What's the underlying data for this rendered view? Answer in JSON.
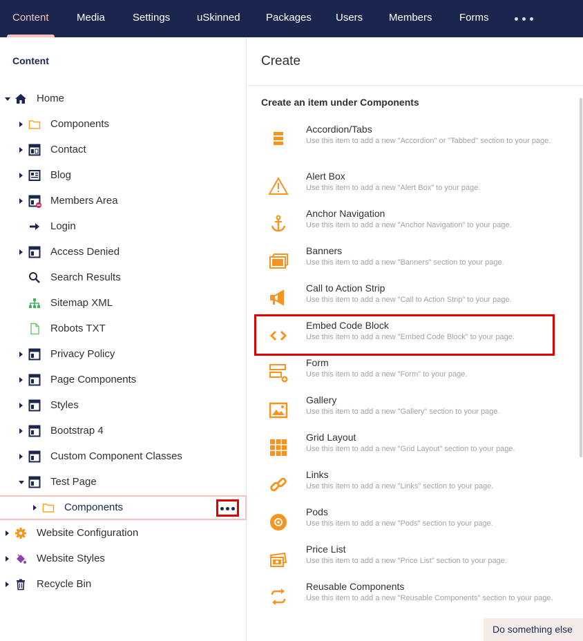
{
  "topnav": {
    "tabs": [
      {
        "label": "Content",
        "active": true
      },
      {
        "label": "Media"
      },
      {
        "label": "Settings"
      },
      {
        "label": "uSkinned"
      },
      {
        "label": "Packages"
      },
      {
        "label": "Users"
      },
      {
        "label": "Members"
      },
      {
        "label": "Forms"
      }
    ]
  },
  "tree": {
    "title": "Content",
    "nodes": [
      {
        "label": "Home",
        "icon": "home-icon"
      },
      {
        "label": "Components",
        "icon": "folder-icon"
      },
      {
        "label": "Contact",
        "icon": "page-layout-icon"
      },
      {
        "label": "Blog",
        "icon": "newspaper-icon"
      },
      {
        "label": "Members Area",
        "icon": "restricted-page-icon"
      },
      {
        "label": "Login",
        "icon": "arrow-right-icon"
      },
      {
        "label": "Access Denied",
        "icon": "page-layout-icon"
      },
      {
        "label": "Search Results",
        "icon": "search-icon"
      },
      {
        "label": "Sitemap XML",
        "icon": "sitemap-icon"
      },
      {
        "label": "Robots TXT",
        "icon": "document-icon"
      },
      {
        "label": "Privacy Policy",
        "icon": "page-layout-icon"
      },
      {
        "label": "Page Components",
        "icon": "page-layout-icon"
      },
      {
        "label": "Styles",
        "icon": "page-layout-icon"
      },
      {
        "label": "Bootstrap 4",
        "icon": "page-layout-icon"
      },
      {
        "label": "Custom Component Classes",
        "icon": "page-layout-icon"
      },
      {
        "label": "Test Page",
        "icon": "page-layout-icon"
      },
      {
        "label": "Components",
        "icon": "folder-icon"
      },
      {
        "label": "Website Configuration",
        "icon": "gear-icon"
      },
      {
        "label": "Website Styles",
        "icon": "paint-icon"
      },
      {
        "label": "Recycle Bin",
        "icon": "trash-icon"
      }
    ]
  },
  "panel": {
    "title": "Create",
    "subtitle": "Create an item under Components",
    "items": [
      {
        "name": "Accordion/Tabs",
        "desc": "Use this item to add a new \"Accordion\" or \"Tabbed\" section to your page.",
        "icon": "accordion-icon"
      },
      {
        "name": "Alert Box",
        "desc": "Use this item to add a new \"Alert Box\" to your page.",
        "icon": "alert-icon"
      },
      {
        "name": "Anchor Navigation",
        "desc": "Use this item to add a new \"Anchor Navigation\" to your page.",
        "icon": "anchor-icon"
      },
      {
        "name": "Banners",
        "desc": "Use this item to add a new \"Banners\" section to your page.",
        "icon": "banners-icon"
      },
      {
        "name": "Call to Action Strip",
        "desc": "Use this item to add a new \"Call to Action Strip\" to your page.",
        "icon": "megaphone-icon"
      },
      {
        "name": "Embed Code Block",
        "desc": "Use this item to add a new \"Embed Code Block\" to your page.",
        "icon": "code-icon"
      },
      {
        "name": "Form",
        "desc": "Use this item to add a new \"Form\" to your page.",
        "icon": "form-icon"
      },
      {
        "name": "Gallery",
        "desc": "Use this item to add a new \"Gallery\" section to your page.",
        "icon": "gallery-icon"
      },
      {
        "name": "Grid Layout",
        "desc": "Use this item to add a new \"Grid Layout\" section to your page.",
        "icon": "grid-icon"
      },
      {
        "name": "Links",
        "desc": "Use this item to add a new \"Links\" section to your page.",
        "icon": "link-icon"
      },
      {
        "name": "Pods",
        "desc": "Use this item to add a new \"Pods\" section to your page.",
        "icon": "pods-icon"
      },
      {
        "name": "Price List",
        "desc": "Use this item to add a new \"Price List\" section to your page.",
        "icon": "price-list-icon"
      },
      {
        "name": "Reusable Components",
        "desc": "Use this item to add a new \"Reusable Components\" section to your page.",
        "icon": "reusable-icon"
      }
    ]
  },
  "footer": {
    "do_something_else": "Do something else"
  },
  "colors": {
    "nav_bg": "#1b264f",
    "accent": "#f5c1bc",
    "icon_orange": "#f7931e",
    "highlight": "#e00000"
  }
}
